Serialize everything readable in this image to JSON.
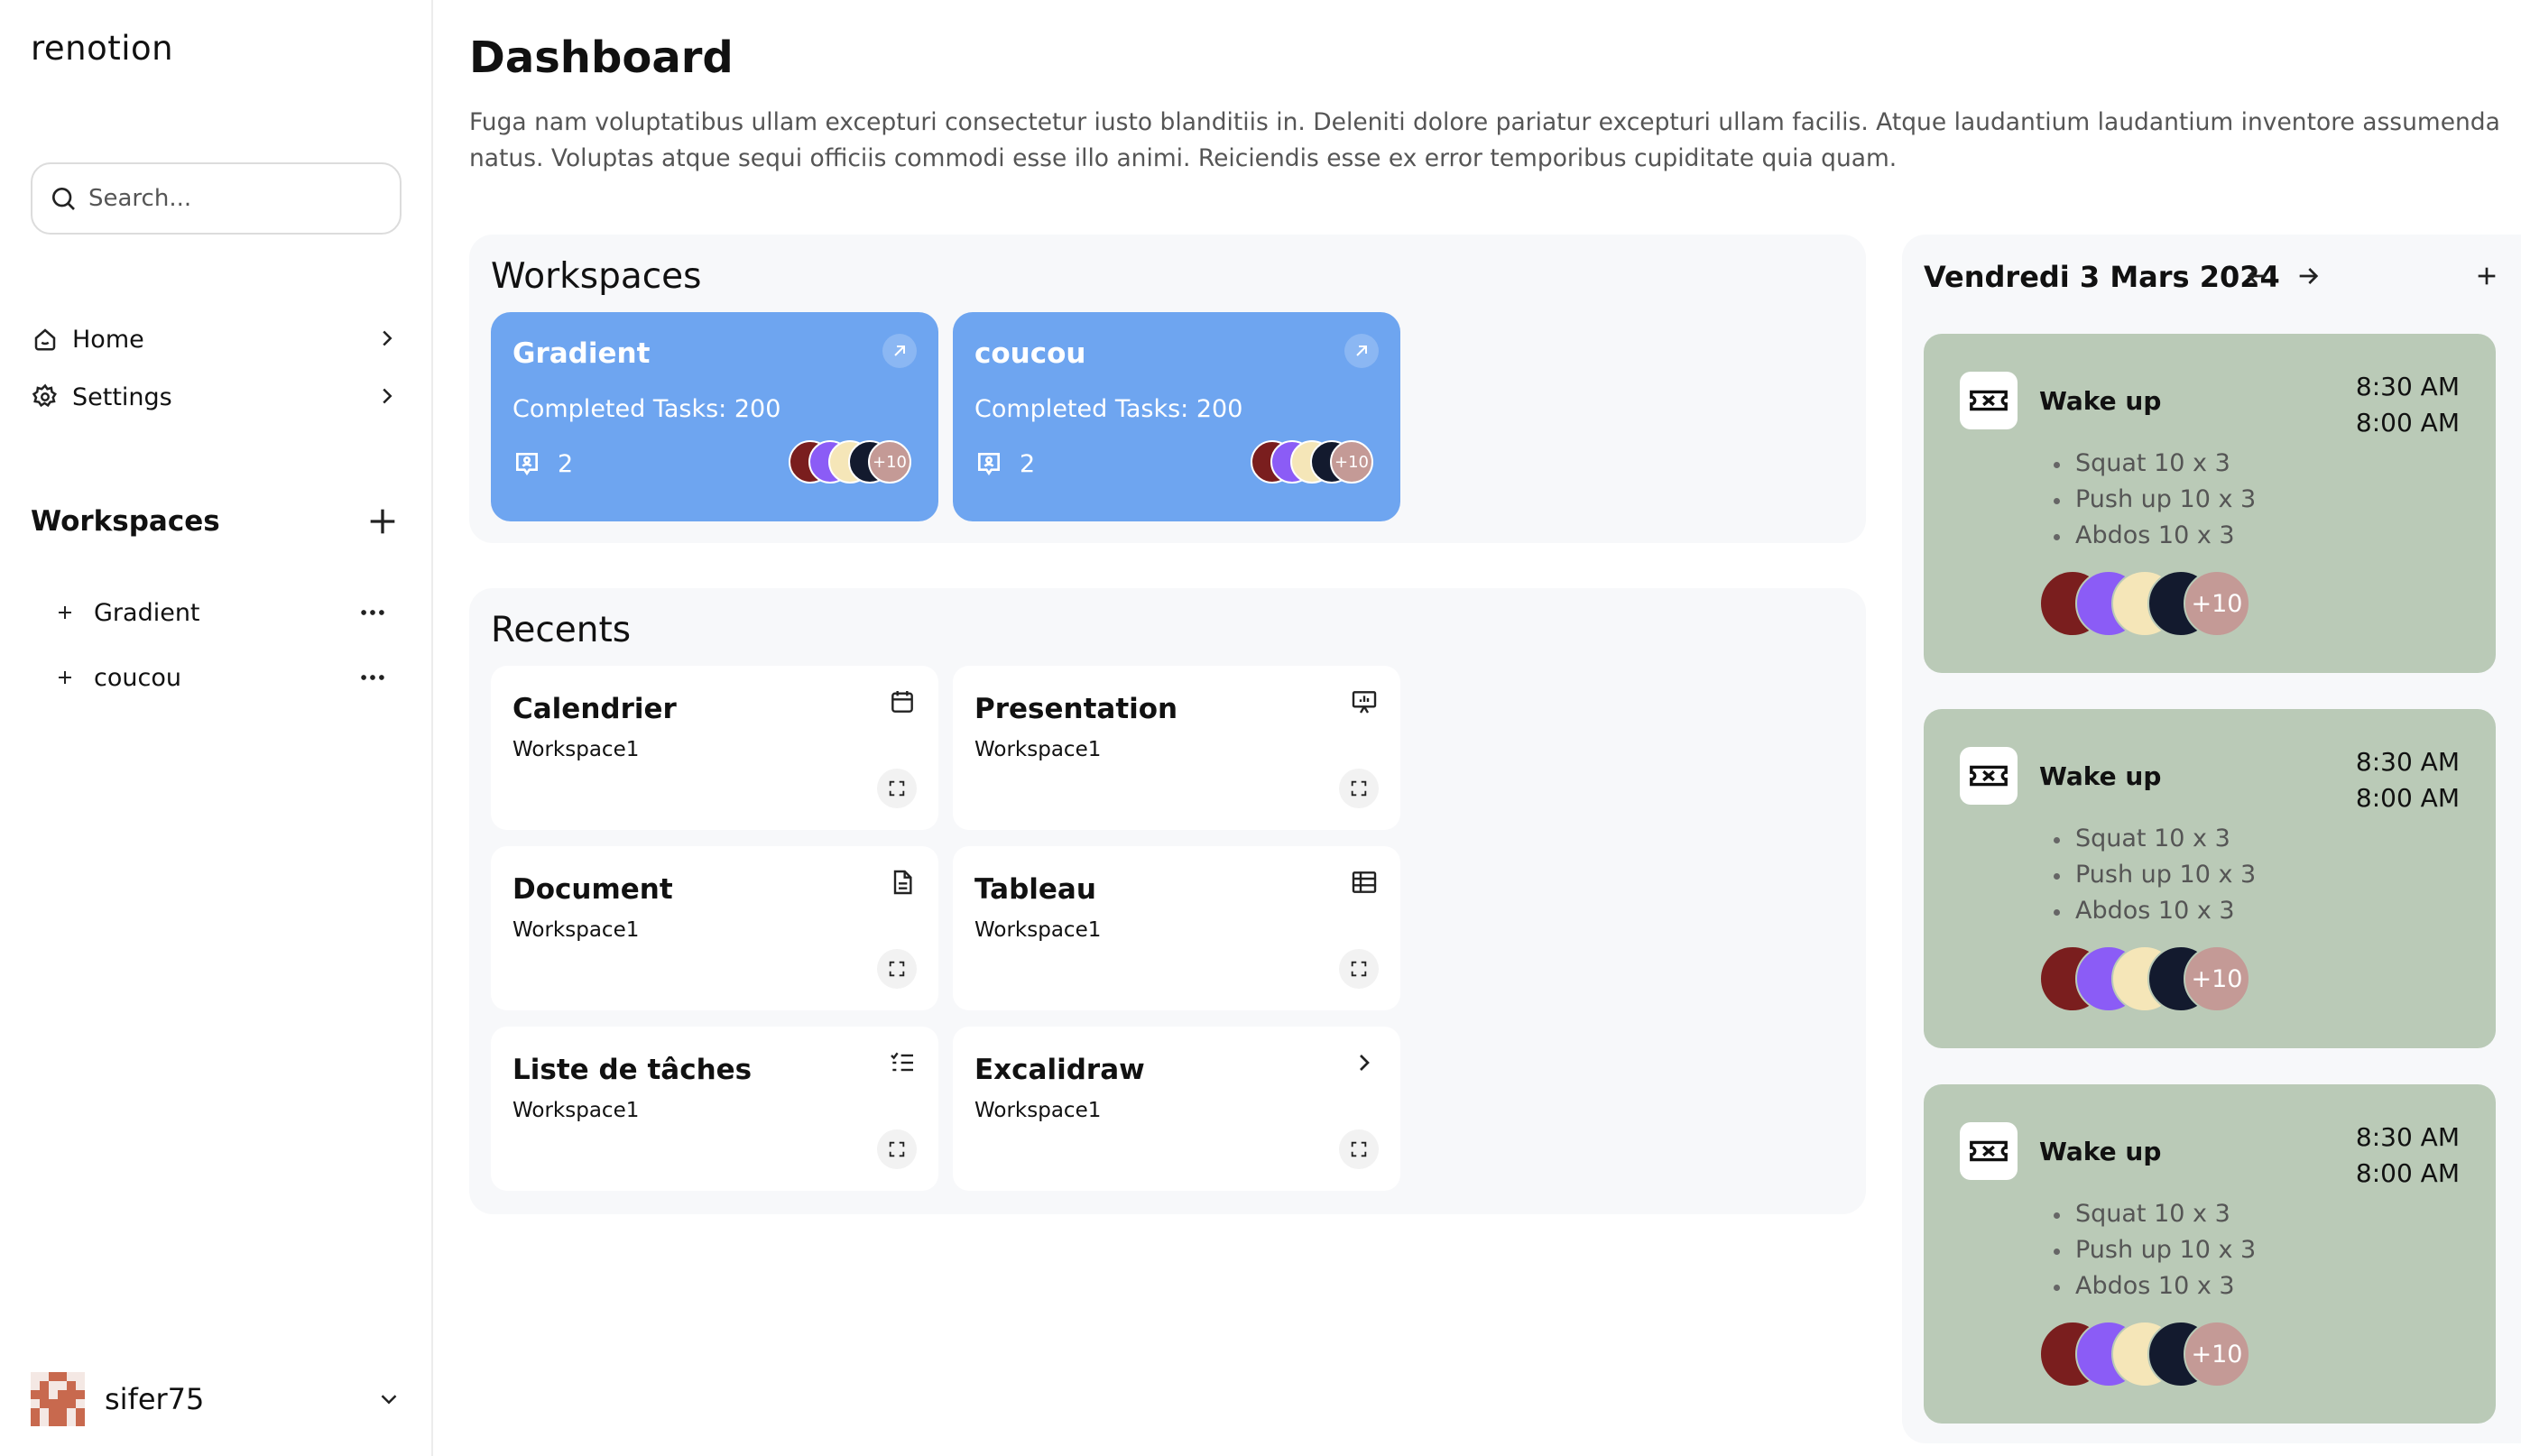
{
  "sidebar": {
    "brand": "renotion",
    "search_placeholder": "Search...",
    "nav": [
      {
        "label": "Home",
        "icon": "home-icon"
      },
      {
        "label": "Settings",
        "icon": "gear-icon"
      }
    ],
    "workspaces_title": "Workspaces",
    "workspaces": [
      {
        "label": "Gradient"
      },
      {
        "label": "coucou"
      }
    ],
    "user": {
      "name": "sifer75"
    }
  },
  "main": {
    "title": "Dashboard",
    "description": "Fuga nam voluptatibus ullam excepturi consectetur iusto blanditiis in. Deleniti dolore pariatur excepturi ullam facilis. Atque laudantium laudantium inventore assumenda",
    "description_line2": "natus. Voluptas atque sequi officiis commodi esse illo animi. Reiciendis esse ex error temporibus cupiditate quia quam.",
    "workspaces_title": "Workspaces",
    "workspace_cards": [
      {
        "name": "Gradient",
        "tasks": "Completed Tasks: 200",
        "members": "2",
        "more": "+10"
      },
      {
        "name": "coucou",
        "tasks": "Completed Tasks: 200",
        "members": "2",
        "more": "+10"
      }
    ],
    "recents_title": "Recents",
    "recents": [
      {
        "name": "Calendrier",
        "workspace": "Workspace1",
        "icon": "calendar-icon"
      },
      {
        "name": "Presentation",
        "workspace": "Workspace1",
        "icon": "presentation-icon"
      },
      {
        "name": "Document",
        "workspace": "Workspace1",
        "icon": "document-icon"
      },
      {
        "name": "Tableau",
        "workspace": "Workspace1",
        "icon": "table-icon"
      },
      {
        "name": "Liste de tâches",
        "workspace": "Workspace1",
        "icon": "list-icon"
      },
      {
        "name": "Excalidraw",
        "workspace": "Workspace1",
        "icon": "chevron-right-icon"
      }
    ]
  },
  "calendar": {
    "date": "Vendredi 3 Mars 2024",
    "events": [
      {
        "title": "Wake up",
        "start": "8:30 AM",
        "end": "8:00 AM",
        "items": [
          "Squat 10 x 3",
          "Push up 10 x 3",
          "Abdos 10 x 3"
        ],
        "more": "+10"
      },
      {
        "title": "Wake up",
        "start": "8:30 AM",
        "end": "8:00 AM",
        "items": [
          "Squat 10 x 3",
          "Push up 10 x 3",
          "Abdos 10 x 3"
        ],
        "more": "+10"
      },
      {
        "title": "Wake up",
        "start": "8:30 AM",
        "end": "8:00 AM",
        "items": [
          "Squat 10 x 3",
          "Push up 10 x 3",
          "Abdos 10 x 3"
        ],
        "more": "+10"
      }
    ]
  },
  "colors": {
    "workspace_card": "#6ea5f0",
    "event_card": "#bacab7",
    "avatar_1": "#7a1e1e",
    "avatar_2": "#8b5cf6",
    "avatar_3": "#f5e6b8",
    "avatar_4": "#131a2e",
    "avatar_more": "#c49a96"
  }
}
